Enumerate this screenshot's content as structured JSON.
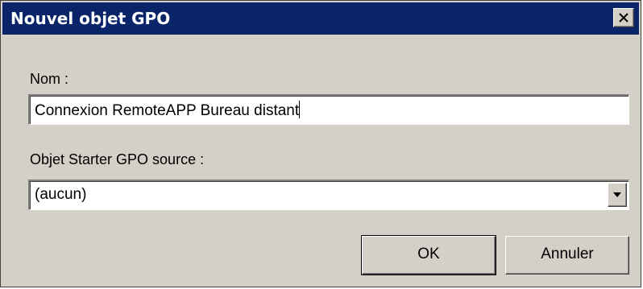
{
  "window": {
    "title": "Nouvel objet GPO"
  },
  "form": {
    "name_label": "Nom :",
    "name_value": "Connexion RemoteAPP Bureau distant",
    "starter_label": "Objet Starter GPO source :",
    "starter_selected": "(aucun)"
  },
  "buttons": {
    "ok_label": "OK",
    "cancel_label": "Annuler"
  },
  "icons": {
    "close": "close-icon",
    "dropdown": "chevron-down-icon"
  },
  "colors": {
    "titlebar": "#0a246a",
    "dialog_bg": "#d4d0c8"
  }
}
